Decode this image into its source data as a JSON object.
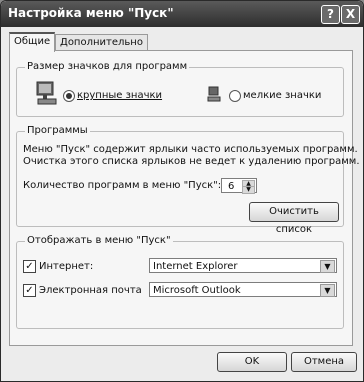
{
  "title": "Настройка меню \"Пуск\"",
  "title_buttons": [
    "?",
    "X"
  ],
  "tabs": [
    "Общие",
    "Дополнительно"
  ],
  "icon_group": {
    "legend": "Размер значков для программ",
    "large_label": "крупные значки",
    "small_label": "мелкие значки",
    "large_icon": "large-computer-icon",
    "small_icon": "small-computer-icon"
  },
  "programs_group": {
    "legend": "Программы",
    "description": [
      "Меню \"Пуск\" содержит ярлыки часто используемых программ.",
      "Очистка этого списка ярлыков не ведет к удалению программ."
    ],
    "count_label": "Количество программ в меню \"Пуск\":",
    "count_value": "6",
    "clear_button": "Очистить список"
  },
  "show_group": {
    "legend": "Отображать в меню \"Пуск\"",
    "internet_label": "Интернет:",
    "internet_value": "Internet Explorer",
    "email_label": "Электронная почта",
    "email_value": "Microsoft Outlook",
    "internet_checked": true,
    "email_checked": true
  },
  "buttons": {
    "ok": "OK",
    "cancel": "Отмена"
  }
}
